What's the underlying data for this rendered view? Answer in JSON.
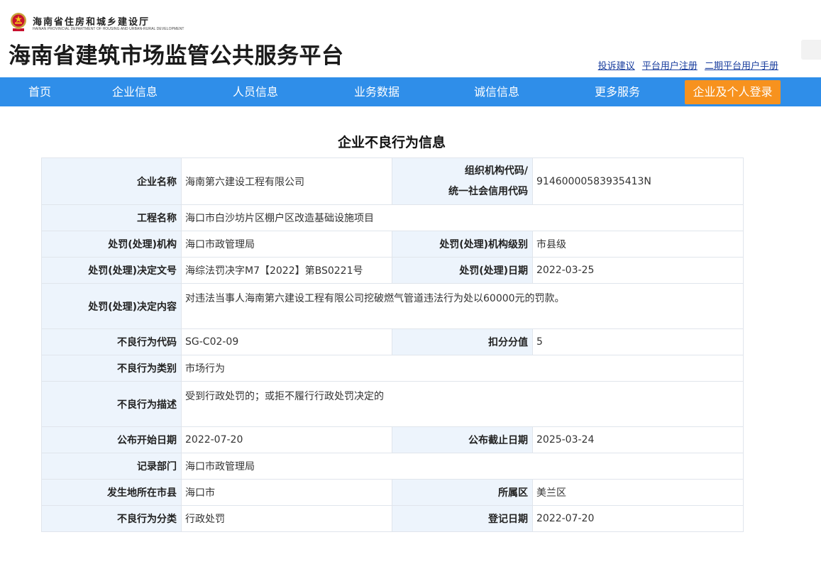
{
  "header": {
    "dept_name": "海南省住房和城乡建设厅",
    "dept_name_en": "HAINAN PROVINCIAL DEPARTMENT OF HOUSING AND URBAN-RURAL DEVELOPMENT",
    "site_title": "海南省建筑市场监管公共服务平台",
    "links": [
      "投诉建议",
      "平台用户注册",
      "二期平台用户手册"
    ]
  },
  "nav": {
    "items": [
      "首页",
      "企业信息",
      "人员信息",
      "业务数据",
      "诚信信息",
      "更多服务"
    ],
    "login_label": "企业及个人登录"
  },
  "page_title": "企业不良行为信息",
  "record": {
    "company_name_label": "企业名称",
    "company_name": "海南第六建设工程有限公司",
    "org_code_label_1": "组织机构代码/",
    "org_code_label_2": "统一社会信用代码",
    "org_code": "91460000583935413N",
    "project_label": "工程名称",
    "project": "海口市白沙坊片区棚户区改造基础设施项目",
    "authority_label": "处罚(处理)机构",
    "authority": "海口市政管理局",
    "authority_level_label": "处罚(处理)机构级别",
    "authority_level": "市县级",
    "decision_no_label": "处罚(处理)决定文号",
    "decision_no": "海综法罚决字M7【2022】第BS0221号",
    "decision_date_label": "处罚(处理)日期",
    "decision_date": "2022-03-25",
    "decision_content_label": "处罚(处理)决定内容",
    "decision_content": "对违法当事人海南第六建设工程有限公司挖破燃气管道违法行为处以60000元的罚款。",
    "behavior_code_label": "不良行为代码",
    "behavior_code": "SG-C02-09",
    "deduction_label": "扣分分值",
    "deduction": "5",
    "behavior_category_label": "不良行为类别",
    "behavior_category": "市场行为",
    "behavior_desc_label": "不良行为描述",
    "behavior_desc": "受到行政处罚的；或拒不履行行政处罚决定的",
    "publish_start_label": "公布开始日期",
    "publish_start": "2022-07-20",
    "publish_end_label": "公布截止日期",
    "publish_end": "2025-03-24",
    "record_dept_label": "记录部门",
    "record_dept": "海口市政管理局",
    "city_label": "发生地所在市县",
    "city": "海口市",
    "district_label": "所属区",
    "district": "美兰区",
    "classification_label": "不良行为分类",
    "classification": "行政处罚",
    "register_date_label": "登记日期",
    "register_date": "2022-07-20"
  },
  "icons": {
    "emblem": "national-emblem-icon"
  },
  "colors": {
    "nav_bg": "#2f8ee9",
    "login_bg": "#f7921e",
    "label_bg": "#edf4fc",
    "link": "#1a3e9e"
  }
}
